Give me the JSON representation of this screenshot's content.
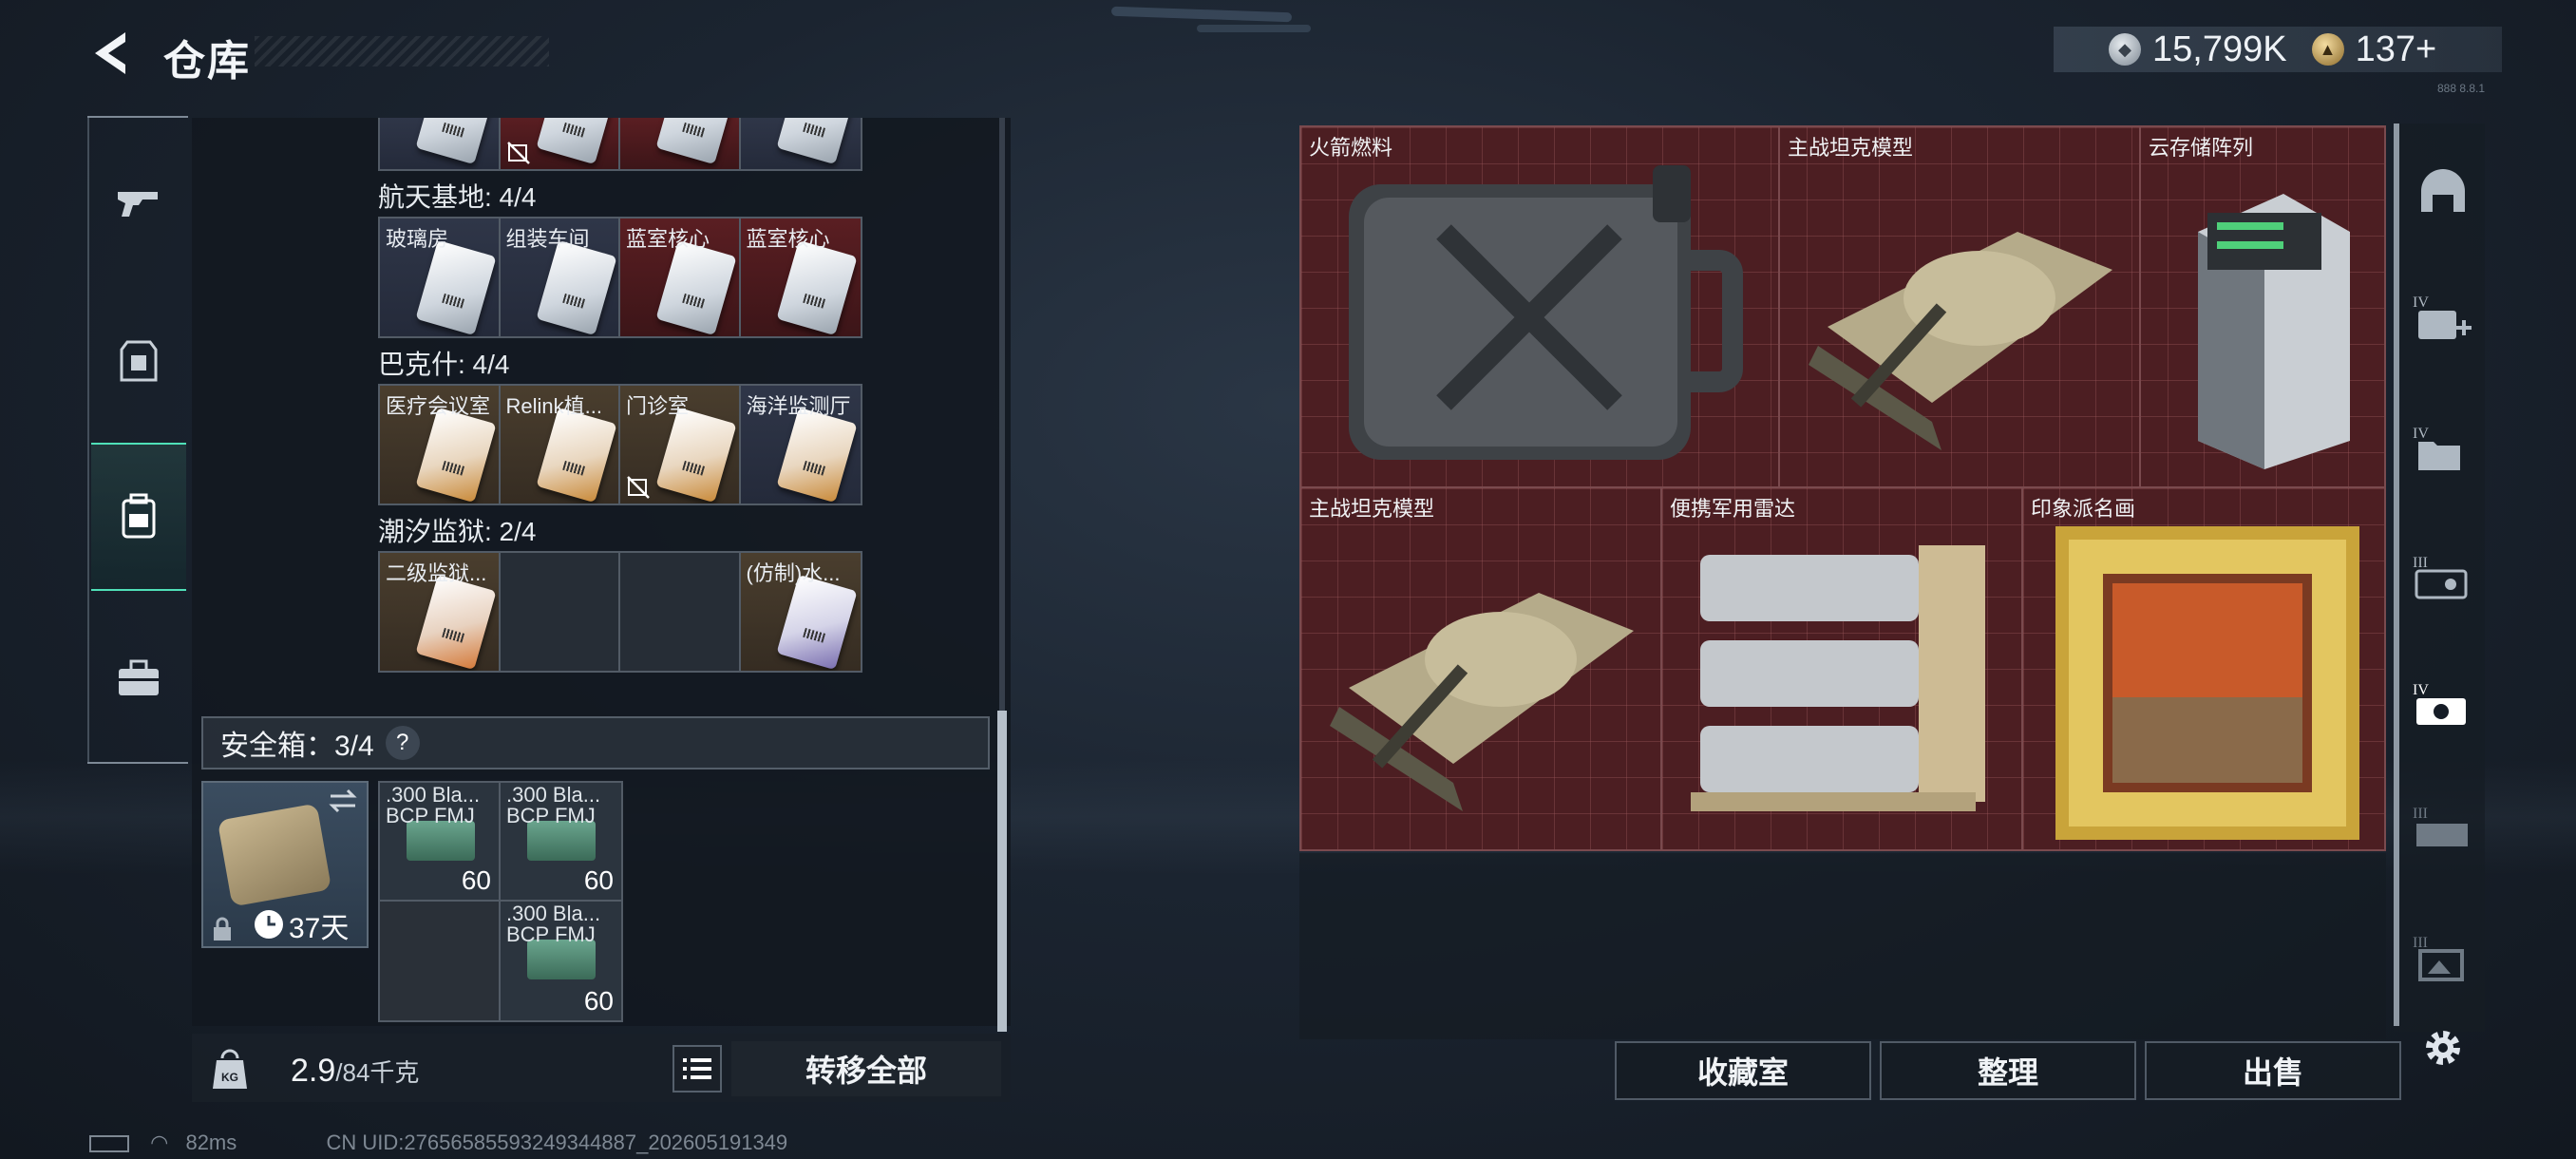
{
  "header": {
    "title": "仓库",
    "currency1": "15,799K",
    "currency2": "137+",
    "tiny_text": "888 8.8.1"
  },
  "left_tabs": [
    {
      "icon": "gun-icon",
      "active": false
    },
    {
      "icon": "armor-icon",
      "active": false
    },
    {
      "icon": "backpack-icon",
      "active": true
    },
    {
      "icon": "toolbox-icon",
      "active": false
    }
  ],
  "groups": [
    {
      "label": "航天基地: 4/4",
      "items": [
        {
          "name": "玻璃房",
          "rarity": "blue"
        },
        {
          "name": "组装车间",
          "rarity": "blue"
        },
        {
          "name": "蓝室核心",
          "rarity": "red"
        },
        {
          "name": "蓝室核心",
          "rarity": "red"
        }
      ]
    },
    {
      "label": "巴克什: 4/4",
      "items": [
        {
          "name": "医疗会议室",
          "rarity": "gold"
        },
        {
          "name": "Relink植...",
          "rarity": "gold"
        },
        {
          "name": "门诊室",
          "rarity": "gold"
        },
        {
          "name": "海洋监测厅",
          "rarity": "blue"
        }
      ]
    },
    {
      "label": "潮汐监狱: 2/4",
      "items": [
        {
          "name": "二级监狱...",
          "rarity": "gold"
        },
        {
          "name": "",
          "rarity": "empty"
        },
        {
          "name": "",
          "rarity": "empty"
        },
        {
          "name": "(仿制)水...",
          "rarity": "gold"
        }
      ]
    }
  ],
  "safe_box": {
    "label": "安全箱：3/4",
    "help": "?",
    "days": "37天",
    "ammo": [
      {
        "name": ".300 Bla...\nBCP FMJ",
        "qty": "60"
      },
      {
        "name": ".300 Bla...\nBCP FMJ",
        "qty": "60"
      },
      {
        "name": "",
        "qty": ""
      },
      {
        "name": ".300 Bla...\nBCP FMJ",
        "qty": "60"
      }
    ]
  },
  "bottom_left": {
    "weight": "2.9",
    "weight_max": "/84千克",
    "kg_label": "KG",
    "transfer_all": "转移全部"
  },
  "right_items": [
    {
      "name": "火箭燃料"
    },
    {
      "name": "主战坦克模型"
    },
    {
      "name": "云存储阵列"
    },
    {
      "name": "主战坦克模型"
    },
    {
      "name": "便携军用雷达"
    },
    {
      "name": "印象派名画"
    }
  ],
  "bottom_right": {
    "collection": "收藏室",
    "arrange": "整理",
    "sell": "出售"
  },
  "right_rail": [
    {
      "icon": "helmet-icon",
      "tier": ""
    },
    {
      "icon": "medkit-icon",
      "tier": "IV"
    },
    {
      "icon": "folder-icon",
      "tier": "IV"
    },
    {
      "icon": "console-icon",
      "tier": "III"
    },
    {
      "icon": "camera-icon",
      "tier": "IV"
    },
    {
      "icon": "server-icon",
      "tier": "III"
    },
    {
      "icon": "frame-icon",
      "tier": "III"
    }
  ],
  "status": {
    "ping": "82ms",
    "uid": "CN UID:27656585593249344887_202605191349"
  },
  "colors": {
    "accent": "#4fe0b8",
    "red_item_bg": "#4c1e22"
  }
}
